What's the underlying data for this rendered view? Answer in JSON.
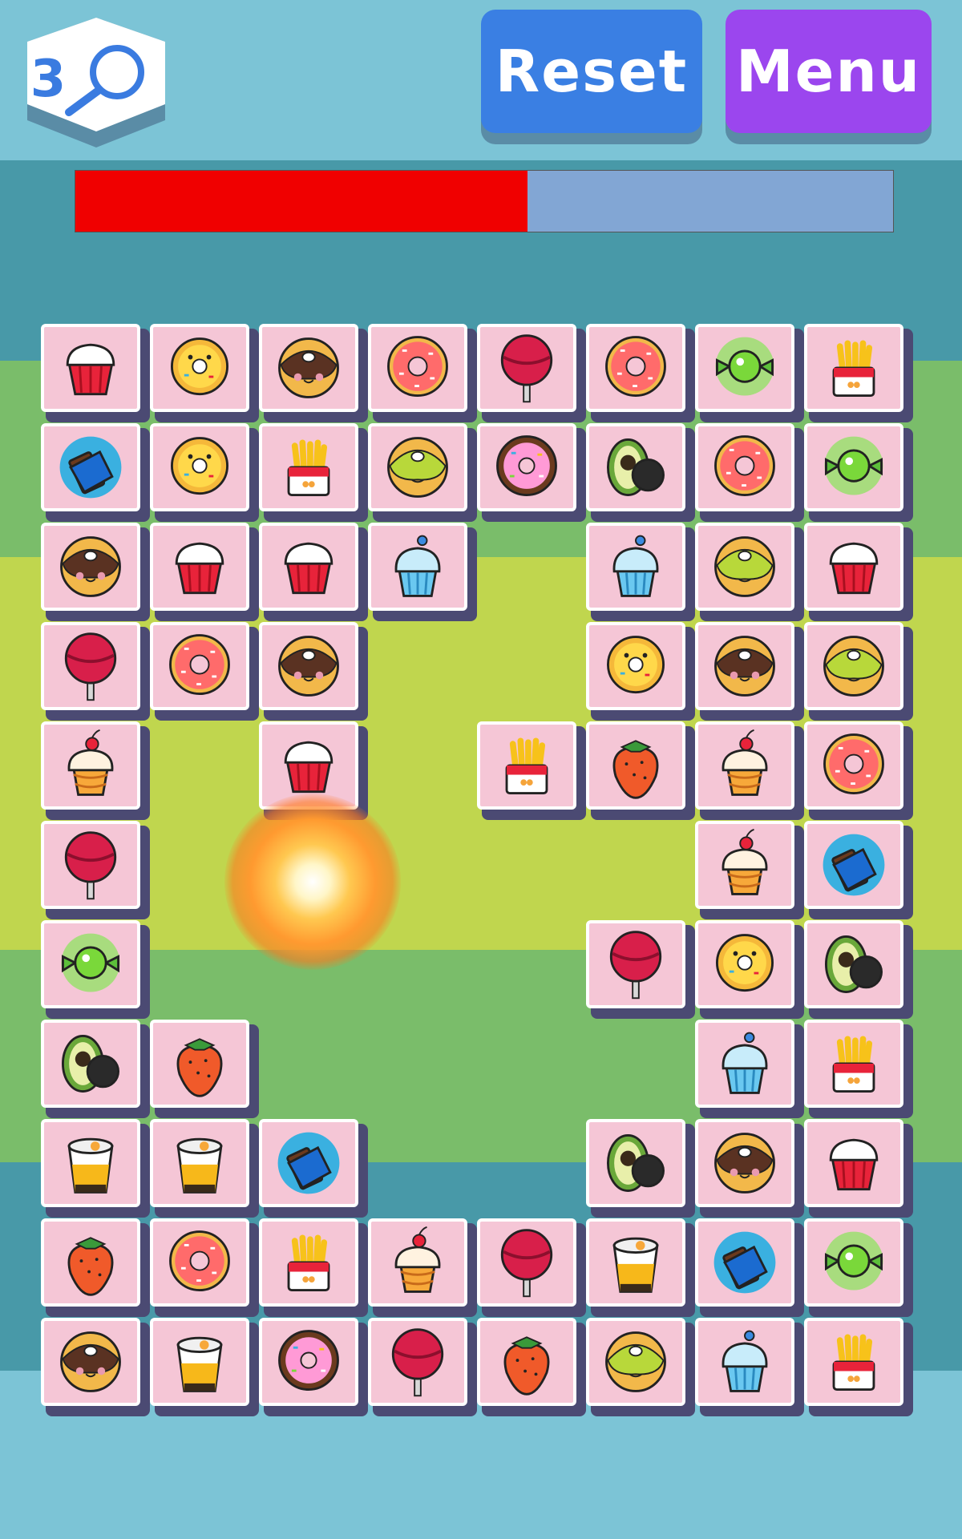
{
  "header": {
    "hint_count": "3",
    "hint_icon": "magnifier-icon",
    "reset_label": "Reset",
    "menu_label": "Menu"
  },
  "timer": {
    "remaining_fraction": 0.553,
    "fill_color": "#f00000",
    "track_color": "#82a6d4"
  },
  "colors": {
    "tile_face": "#f5c6d6",
    "tile_side": "#4b4a73",
    "reset": "#3a7fe3",
    "menu": "#9b46ee"
  },
  "board": {
    "rows": [
      [
        "red-cupcake",
        "yellow-donut",
        "chocolate-donut",
        "pink-donut",
        "lollipop",
        "pink-donut",
        "candy",
        "fries"
      ],
      [
        "chocolate-bar",
        "yellow-donut",
        "fries",
        "green-donut",
        "sprinkle-donut",
        "avocado",
        "pink-donut",
        "candy"
      ],
      [
        "chocolate-donut",
        "red-cupcake",
        "red-cupcake",
        "blue-cupcake",
        null,
        "blue-cupcake",
        "green-donut",
        "red-cupcake"
      ],
      [
        "lollipop",
        "pink-donut",
        "chocolate-donut",
        null,
        null,
        "yellow-donut",
        "chocolate-donut",
        "green-donut"
      ],
      [
        "cherry-cupcake",
        null,
        "red-cupcake",
        null,
        "fries",
        "strawberry",
        "cherry-cupcake",
        "pink-donut"
      ],
      [
        "lollipop",
        null,
        null,
        null,
        null,
        null,
        "cherry-cupcake",
        "chocolate-bar"
      ],
      [
        "candy",
        null,
        null,
        null,
        null,
        "lollipop",
        "yellow-donut",
        "avocado"
      ],
      [
        "avocado",
        "strawberry",
        null,
        null,
        null,
        null,
        "blue-cupcake",
        "fries"
      ],
      [
        "pudding",
        "pudding",
        "chocolate-bar",
        null,
        null,
        "avocado",
        "chocolate-donut",
        "red-cupcake"
      ],
      [
        "strawberry",
        "pink-donut",
        "fries",
        "cherry-cupcake",
        "lollipop",
        "pudding",
        "chocolate-bar",
        "candy"
      ],
      [
        "chocolate-donut",
        "pudding",
        "sprinkle-donut",
        "lollipop",
        "strawberry",
        "green-donut",
        "blue-cupcake",
        "fries"
      ]
    ]
  },
  "effect": "explosion"
}
